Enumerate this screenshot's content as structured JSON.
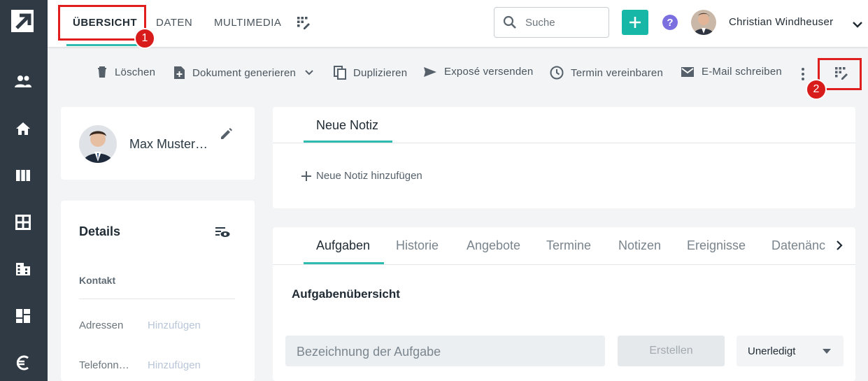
{
  "sidebar": {
    "logo": "arrow-logo-icon",
    "icons": [
      "people-icon",
      "home-icon",
      "columns-icon",
      "grid-icon",
      "building-icon",
      "dashboard-icon",
      "euro-icon"
    ]
  },
  "topnav": {
    "tabs": [
      {
        "label": "ÜBERSICHT",
        "active": true
      },
      {
        "label": "DATEN"
      },
      {
        "label": "MULTIMEDIA"
      }
    ],
    "search_placeholder": "Suche",
    "help_glyph": "?",
    "user_name": "Christian Windheuser"
  },
  "callouts": {
    "first": "1",
    "second": "2"
  },
  "actions": {
    "delete": "Löschen",
    "generate": "Dokument generieren",
    "duplicate": "Duplizieren",
    "send_expose": "Exposé versenden",
    "appointment": "Termin vereinbaren",
    "email": "E-Mail schreiben"
  },
  "contact": {
    "name": "Max Muster…"
  },
  "details": {
    "title": "Details",
    "section": "Kontakt",
    "rows": [
      {
        "label": "Adressen",
        "value": "Hinzufügen"
      },
      {
        "label": "Telefonn…",
        "value": "Hinzufügen"
      }
    ]
  },
  "notes": {
    "tab": "Neue Notiz",
    "add_label": "Neue Notiz hinzufügen"
  },
  "tasks": {
    "tabs": [
      "Aufgaben",
      "Historie",
      "Angebote",
      "Termine",
      "Notizen",
      "Ereignisse",
      "Datenänc"
    ],
    "heading": "Aufgabenübersicht",
    "input_placeholder": "Bezeichnung der Aufgabe",
    "create_label": "Erstellen",
    "status_value": "Unerledigt"
  },
  "colors": {
    "accent": "#17b7a7",
    "sidebar": "#2f3a45",
    "callout": "#e01e1e"
  }
}
